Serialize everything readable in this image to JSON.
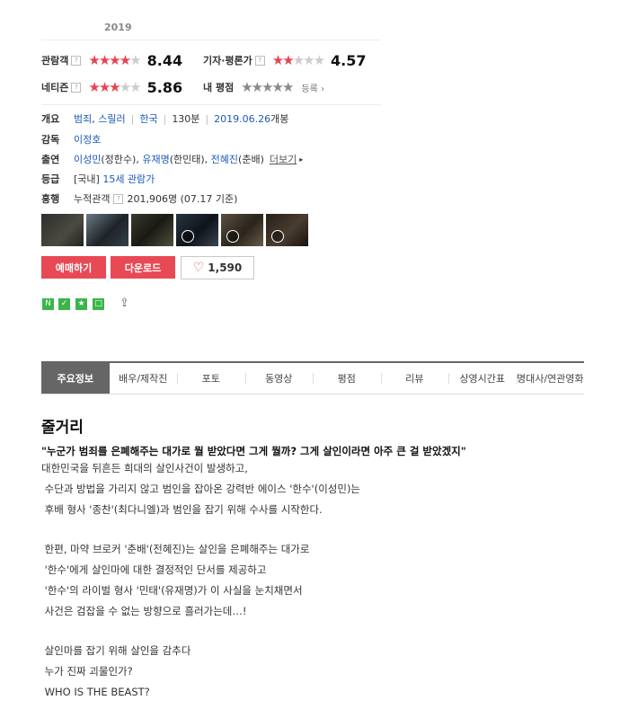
{
  "year": "2019",
  "ratings": {
    "audience": {
      "label": "관람객",
      "score": "8.44",
      "stars": 4.2
    },
    "critic": {
      "label": "기자·평론가",
      "score": "4.57",
      "stars": 2.3
    },
    "netizen": {
      "label": "네티즌",
      "score": "5.86",
      "stars": 2.9
    },
    "my_rating": {
      "label": "내 평점",
      "register": "등록"
    }
  },
  "info": {
    "overview_key": "개요",
    "genres": [
      "범죄",
      "스릴러"
    ],
    "country": "한국",
    "runtime": "130분",
    "release_date": "2019.06.26",
    "release_suffix": "개봉",
    "director_key": "감독",
    "director": "이정호",
    "cast_key": "출연",
    "cast": [
      {
        "name": "이성민",
        "role": "(정한수)"
      },
      {
        "name": "유재명",
        "role": "(한민태)"
      },
      {
        "name": "전혜진",
        "role": "(춘배)"
      }
    ],
    "more": "더보기",
    "grade_key": "등급",
    "grade_region": "[국내]",
    "grade": "15세 관람가",
    "box_key": "흥행",
    "box_label": "누적관객",
    "box_value": "201,906명",
    "box_date": "(07.17 기준)"
  },
  "buttons": {
    "reserve": "예매하기",
    "download": "다운로드",
    "likes": "1,590"
  },
  "tabs": [
    "주요정보",
    "배우/제작진",
    "포토",
    "동영상",
    "평점",
    "리뷰",
    "상영시간표",
    "명대사/연관영화"
  ],
  "synopsis": {
    "heading": "줄거리",
    "tagline": "\"누군가 범죄를 은폐해주는 대가로 뭘 받았다면 그게 뭘까? 그게 살인이라면 아주 큰 걸 받았겠지\"",
    "para1": "대한민국을 뒤흔든 희대의 살인사건이 발생하고,\n 수단과 방법을 가리지 않고 범인을 잡아온 강력반 에이스 '한수'(이성민)는\n 후배 형사 '종찬'(최다니엘)과 범인을 잡기 위해 수사를 시작한다.",
    "para2": " 한편, 마약 브로커 '춘배'(전혜진)는 살인을 은폐해주는 대가로\n '한수'에게 살인마에 대한 결정적인 단서를 제공하고\n '한수'의 라이벌 형사 '민태'(유재명)가 이 사실을 눈치채면서\n 사건은 검잡을 수 없는 방향으로 흘러가는데…!",
    "para3": " 살인마를 잡기 위해 살인을 감추다\n 누가 진짜 괴물인가?\n WHO IS THE BEAST?"
  }
}
